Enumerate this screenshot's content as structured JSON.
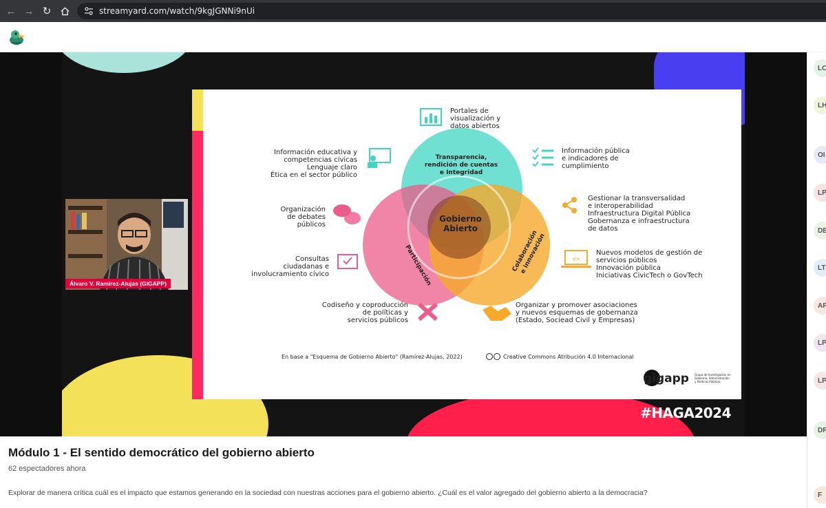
{
  "browser": {
    "url": "streamyard.com/watch/9kgJGNNi9nUi"
  },
  "slide": {
    "center_label_1": "Gobierno",
    "center_label_2": "Abierto",
    "circle_top_1": "Transparencia,",
    "circle_top_2": "rendición de cuentas",
    "circle_top_3": "e Integridad",
    "circle_left": "Participación",
    "circle_right_1": "Colaboración",
    "circle_right_2": "e innovación",
    "item_portales": [
      "Portales de",
      "visualización y",
      "datos abiertos"
    ],
    "item_educativa": [
      "Información educativa y",
      "competencias cívicas",
      "Lenguaje claro",
      "Ética en el sector público"
    ],
    "item_publica": [
      "Información pública",
      "e indicadores de",
      "cumplimiento"
    ],
    "item_debates": [
      "Organización",
      "de debates",
      "públicos"
    ],
    "item_transversal": [
      "Gestionar la transversalidad",
      "e interoperabilidad",
      "Infraestructura Digital Pública",
      "Gobernanza e infraestructura",
      "de datos"
    ],
    "item_consultas": [
      "Consultas",
      "ciudadanas e",
      "involucramiento cívico"
    ],
    "item_modelos": [
      "Nuevos modelos de gestión de",
      "servicios públicos",
      "Innovación pública",
      "Iniciativas CivicTech o GovTech"
    ],
    "item_codiseno": [
      "Codiseño y coproducción",
      "de políticas y",
      "servicios públicos"
    ],
    "item_asociaciones": [
      "Organizar y promover asociaciones",
      "y nuevos esquemas de gobernanza",
      "(Estado, Sociead Civil y Empresas)"
    ],
    "footer": "En base a \"Esquema de Gobierno Abierto\" (Ramírez-Alujas, 2022)",
    "license": "Creative Commons Atribución 4.0 Internacional",
    "logo_text": "gigapp",
    "logo_sub": [
      "Grupo de Investigación en",
      "Gobierno, Administración",
      "y Políticas Públicas"
    ]
  },
  "camera": {
    "name_tag": "Álvaro V. Ramírez-Alujas (GIGAPP)"
  },
  "hashtag": "#HAGA2024",
  "viewers_sidebar": [
    "LC",
    "LH",
    "OI",
    "LP",
    "DE",
    "LT",
    "AF",
    "LP",
    "LP",
    "DP",
    "F"
  ],
  "info": {
    "title": "Módulo 1 - El sentido democrático del gobierno abierto",
    "viewers": "62 espectadores ahora",
    "description": "Explorar de manera crítica cuál es el impacto que estamos generando en la sociedad con nuestras acciones para el gobierno abierto. ¿Cuál es el valor agregado del gobierno abierto a la democracia?"
  },
  "colors": {
    "teal": "#3fd6c1",
    "pink": "#ec5c8a",
    "orange": "#f6a92c",
    "hashtag_bg": "#141414",
    "name_tag": "#e4003a"
  }
}
